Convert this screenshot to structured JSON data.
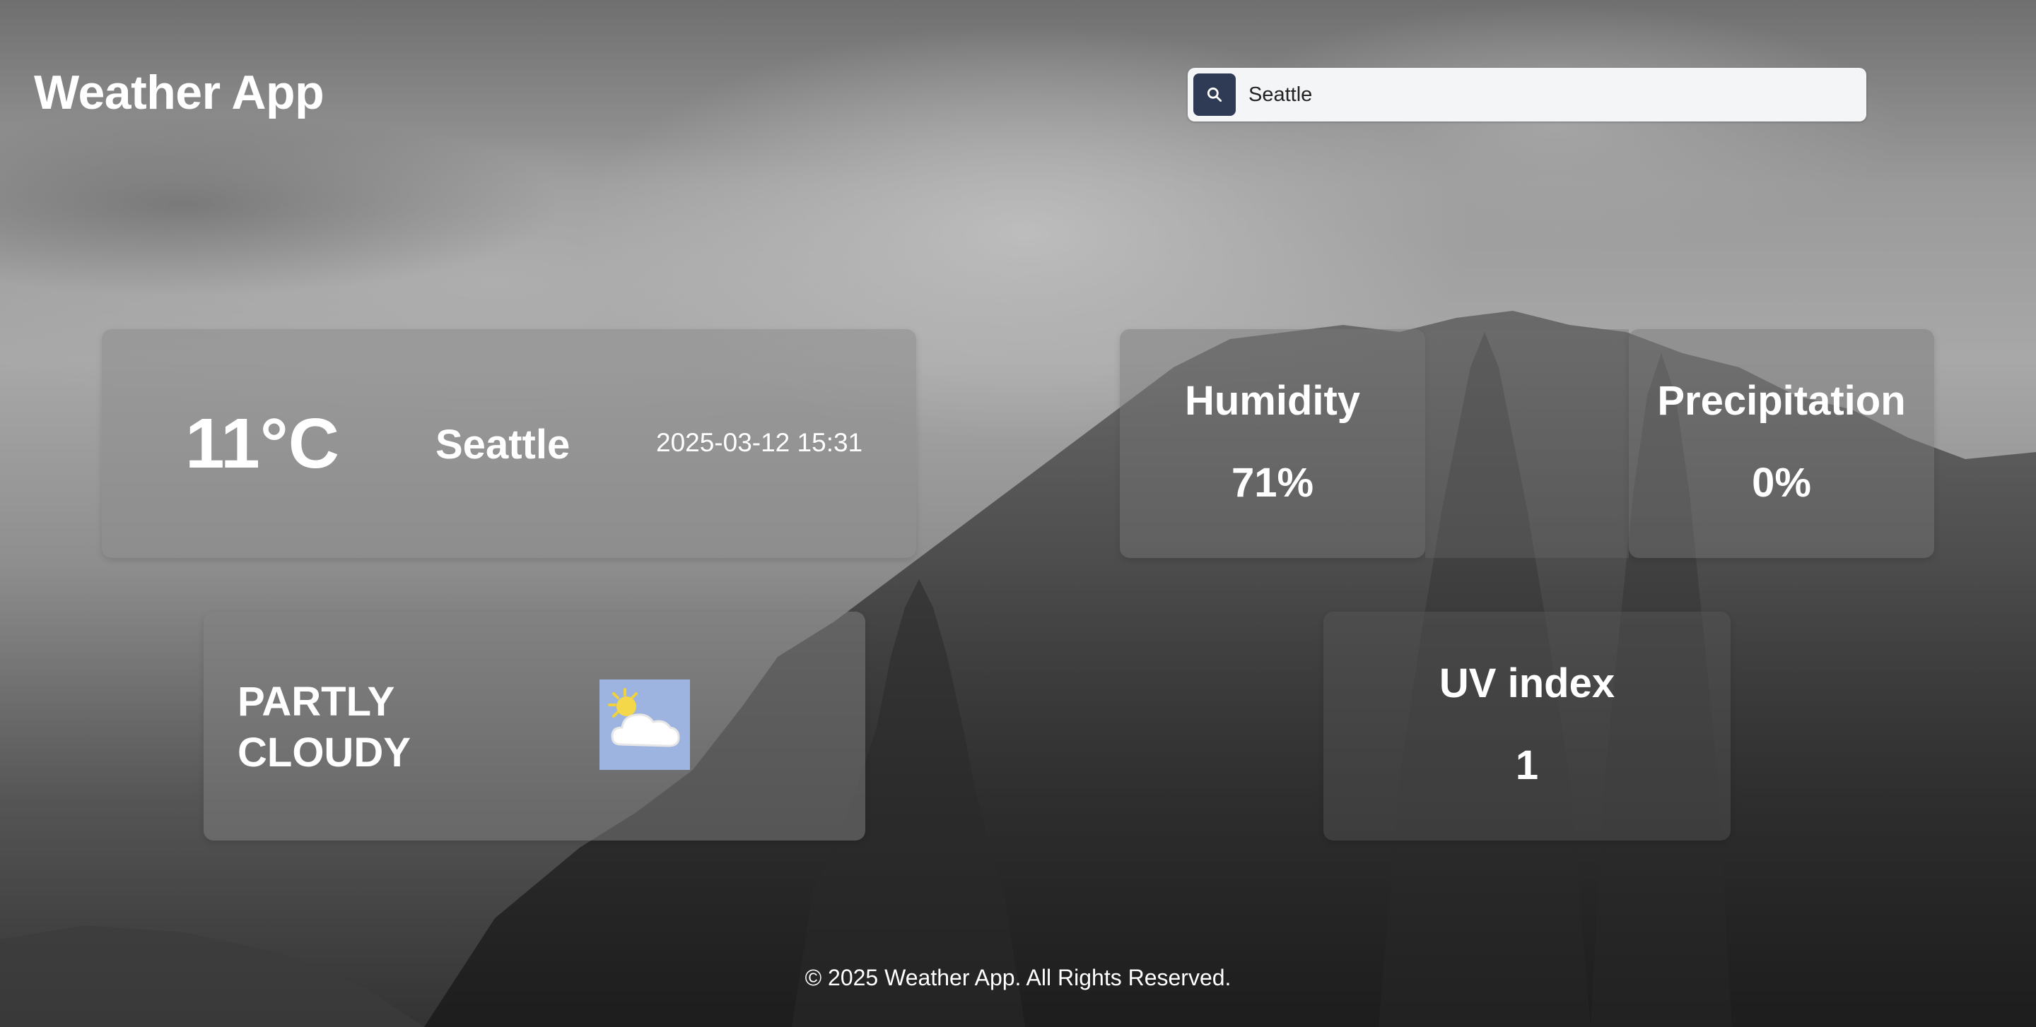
{
  "header": {
    "title": "Weather App"
  },
  "search": {
    "value": "Seattle",
    "icon": "search-icon"
  },
  "current": {
    "temperature": "11°C",
    "city": "Seattle",
    "datetime": "2025-03-12 15:31"
  },
  "condition": {
    "text": "PARTLY CLOUDY",
    "icon": "partly-cloudy-icon"
  },
  "stats": {
    "humidity": {
      "label": "Humidity",
      "value": "71%"
    },
    "precipitation": {
      "label": "Precipitation",
      "value": "0%"
    },
    "uv": {
      "label": "UV index",
      "value": "1"
    }
  },
  "footer": {
    "text": "© 2025 Weather App. All Rights Reserved."
  },
  "colors": {
    "search_button": "#2f3b55",
    "icon_bg": "#9db3e0"
  }
}
